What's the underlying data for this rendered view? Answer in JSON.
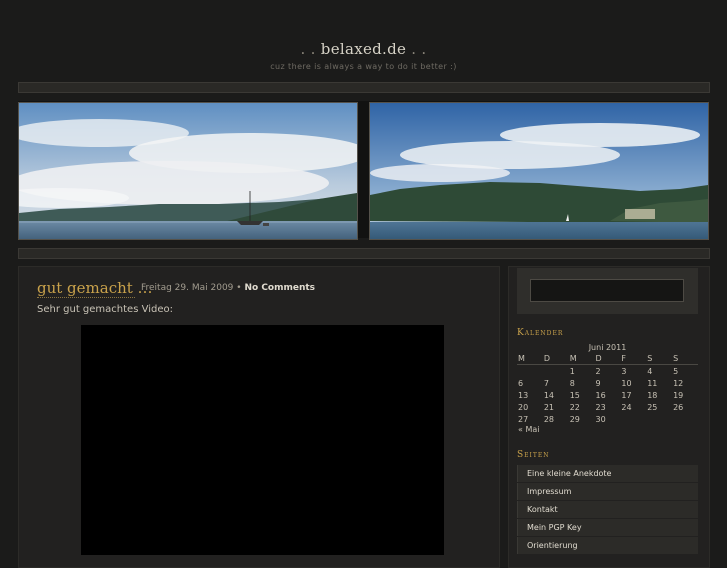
{
  "site": {
    "title_dots_left": ". .",
    "title": "belaxed.de",
    "title_dots_right": ". .",
    "tagline": "cuz there is always a way to do it better :)"
  },
  "post": {
    "title": "gut gemacht …",
    "date": "Freitag 29. Mai 2009",
    "separator": "•",
    "comments": "No Comments",
    "text": "Sehr gut gemachtes Video:"
  },
  "calendar": {
    "heading": "Kalender",
    "caption": "Juni 2011",
    "weekdays": [
      "M",
      "D",
      "M",
      "D",
      "F",
      "S",
      "S"
    ],
    "weeks": [
      [
        "",
        "",
        "1",
        "2",
        "3",
        "4",
        "5"
      ],
      [
        "6",
        "7",
        "8",
        "9",
        "10",
        "11",
        "12"
      ],
      [
        "13",
        "14",
        "15",
        "16",
        "17",
        "18",
        "19"
      ],
      [
        "20",
        "21",
        "22",
        "23",
        "24",
        "25",
        "26"
      ],
      [
        "27",
        "28",
        "29",
        "30",
        "",
        "",
        ""
      ]
    ],
    "prev_link": "« Mai"
  },
  "pages": {
    "heading": "Seiten",
    "items": [
      "Eine kleine Anekdote",
      "Impressum",
      "Kontakt",
      "Mein PGP Key",
      "Orientierung"
    ]
  },
  "colors": {
    "background": "#1b1b1a",
    "accent": "#c9a24b",
    "panel": "#222120"
  }
}
